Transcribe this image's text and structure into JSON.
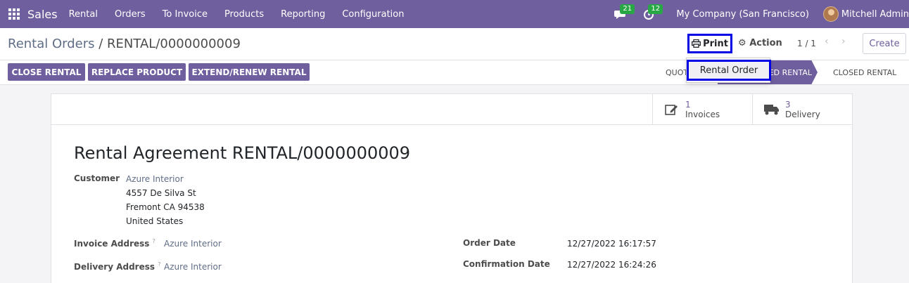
{
  "topnav": {
    "app_name": "Sales",
    "menu": [
      "Rental",
      "Orders",
      "To Invoice",
      "Products",
      "Reporting",
      "Configuration"
    ],
    "messages_count": "21",
    "activities_count": "12",
    "company": "My Company (San Francisco)",
    "user": "Mitchell Admin"
  },
  "control": {
    "breadcrumb_parent": "Rental Orders",
    "breadcrumb_sep": " / ",
    "breadcrumb_current": "RENTAL/0000000009",
    "print_label": "Print",
    "action_label": "Action",
    "pager": "1 / 1",
    "pager_prev": "‹",
    "pager_next": "›",
    "create_label": "Create"
  },
  "dropdown": {
    "item": "Rental Order"
  },
  "statusbar": {
    "buttons": [
      "CLOSE RENTAL",
      "REPLACE PRODUCT",
      "EXTEND/RENEW RENTAL"
    ],
    "stage_partial": "QUOT",
    "stage_active": "ED RENTAL",
    "stage_last": "CLOSED RENTAL"
  },
  "smart_buttons": {
    "invoices_count": "1",
    "invoices_label": "Invoices",
    "delivery_count": "3",
    "delivery_label": "Delivery"
  },
  "form": {
    "title": "Rental Agreement RENTAL/0000000009",
    "customer_label": "Customer",
    "customer_name": "Azure Interior",
    "address_line1": "4557 De Silva St",
    "address_line2": "Fremont CA 94538",
    "address_line3": "United States",
    "invoice_address_label": "Invoice Address",
    "invoice_address": "Azure Interior",
    "delivery_address_label": "Delivery Address",
    "delivery_address": "Azure Interior",
    "help_mark": "?",
    "order_date_label": "Order Date",
    "order_date": "12/27/2022 16:17:57",
    "confirmation_date_label": "Confirmation Date",
    "confirmation_date": "12/27/2022 16:24:26"
  },
  "colors": {
    "brand": "#6f5f9e",
    "highlight": "#0000e6",
    "badge": "#28a745"
  }
}
